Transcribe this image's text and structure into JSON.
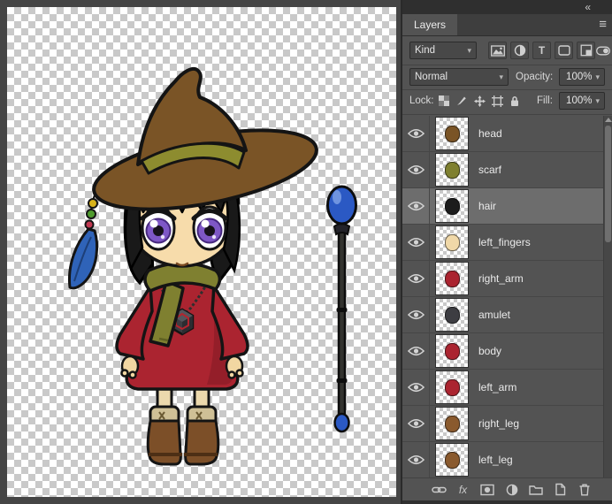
{
  "window": {
    "collapse_icon": "«",
    "panel_menu_icon": "≡"
  },
  "panel": {
    "tab_label": "Layers",
    "filter_row": {
      "kind_label": "Kind",
      "type_glyph": "T"
    },
    "blend_row": {
      "mode": "Normal",
      "opacity_label": "Opacity:",
      "opacity_value": "100%"
    },
    "lock_row": {
      "label": "Lock:",
      "fill_label": "Fill:",
      "fill_value": "100%"
    },
    "layers": [
      {
        "name": "head",
        "thumb_color": "#7a5426",
        "selected": false
      },
      {
        "name": "scarf",
        "thumb_color": "#7f8030",
        "selected": false
      },
      {
        "name": "hair",
        "thumb_color": "#1c1c1c",
        "selected": true
      },
      {
        "name": "left_fingers",
        "thumb_color": "#f0d8a8",
        "selected": false
      },
      {
        "name": "right_arm",
        "thumb_color": "#ab2430",
        "selected": false
      },
      {
        "name": "amulet",
        "thumb_color": "#3d3d42",
        "selected": false
      },
      {
        "name": "body",
        "thumb_color": "#ab2430",
        "selected": false
      },
      {
        "name": "left_arm",
        "thumb_color": "#ab2430",
        "selected": false
      },
      {
        "name": "right_leg",
        "thumb_color": "#8a5a2e",
        "selected": false
      },
      {
        "name": "left_leg",
        "thumb_color": "#8a5a2e",
        "selected": false
      }
    ],
    "footer": {
      "fx_label": "fx"
    }
  },
  "colors": {
    "panel_bg": "#535353",
    "selected_row": "#6d6d6d",
    "dress_red": "#ab2430",
    "scarf_olive": "#7f8030",
    "hat_brown": "#7a5426",
    "orb_blue": "#2b59c4",
    "eye_purple": "#7e57c6"
  }
}
